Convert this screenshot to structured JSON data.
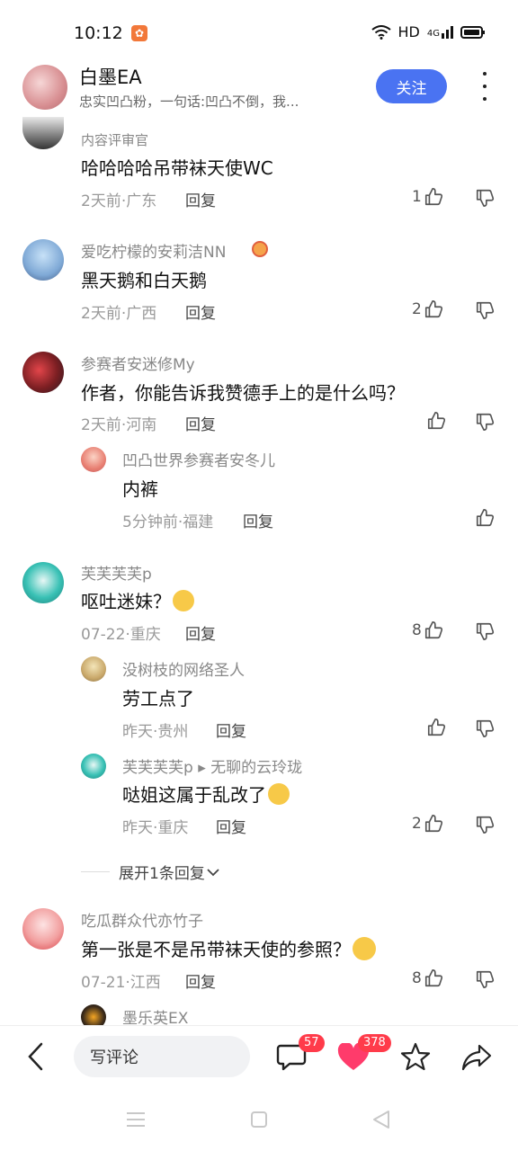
{
  "status": {
    "time": "10:12",
    "network": "HD",
    "signal_label": "4G"
  },
  "header": {
    "username": "白墨EA",
    "description": "忠实凹凸粉，一句话:凹凸不倒，我...",
    "follow_label": "关注"
  },
  "comments": [
    {
      "name": "",
      "role_tag": "内容评审官",
      "text": "哈哈哈哈吊带袜天使WC",
      "meta": "2天前·广东",
      "reply": "回复",
      "likes": "1"
    },
    {
      "name": "爱吃柠檬的安莉洁NN",
      "text": "黑天鹅和白天鹅",
      "meta": "2天前·广西",
      "reply": "回复",
      "likes": "2"
    },
    {
      "name": "参赛者安迷修My",
      "text": "作者，你能告诉我赞德手上的是什么吗？",
      "meta": "2天前·河南",
      "reply": "回复",
      "likes": ""
    },
    {
      "name": "芙芙芙芙p",
      "text": "呕吐迷妹？",
      "meta": "07-22·重庆",
      "reply": "回复",
      "likes": "8"
    },
    {
      "name": "吃瓜群众代亦竹子",
      "text": "第一张是不是吊带袜天使的参照？",
      "meta": "07-21·江西",
      "reply": "回复",
      "likes": "8"
    }
  ],
  "replies": [
    {
      "name": "凹凸世界参赛者安冬儿",
      "text": "内裤",
      "meta": "5分钟前·福建",
      "reply": "回复"
    },
    {
      "name": "没树枝的网络圣人",
      "text": "劳工点了",
      "meta": "昨天·贵州",
      "reply": "回复",
      "likes": ""
    },
    {
      "name": "芙芙芙芙p ▸ 无聊的云玲珑",
      "text": "哒姐这属于乱改了",
      "meta": "昨天·重庆",
      "reply": "回复",
      "likes": "2"
    },
    {
      "name": "墨乐英EX"
    }
  ],
  "expand_label": "展开1条回复",
  "bottom": {
    "write_placeholder": "写评论",
    "comment_count": "57",
    "like_count": "378"
  },
  "colors": {
    "accent": "#4a73f2",
    "badge": "#ff3b4a",
    "heart": "#ff3b6b"
  }
}
